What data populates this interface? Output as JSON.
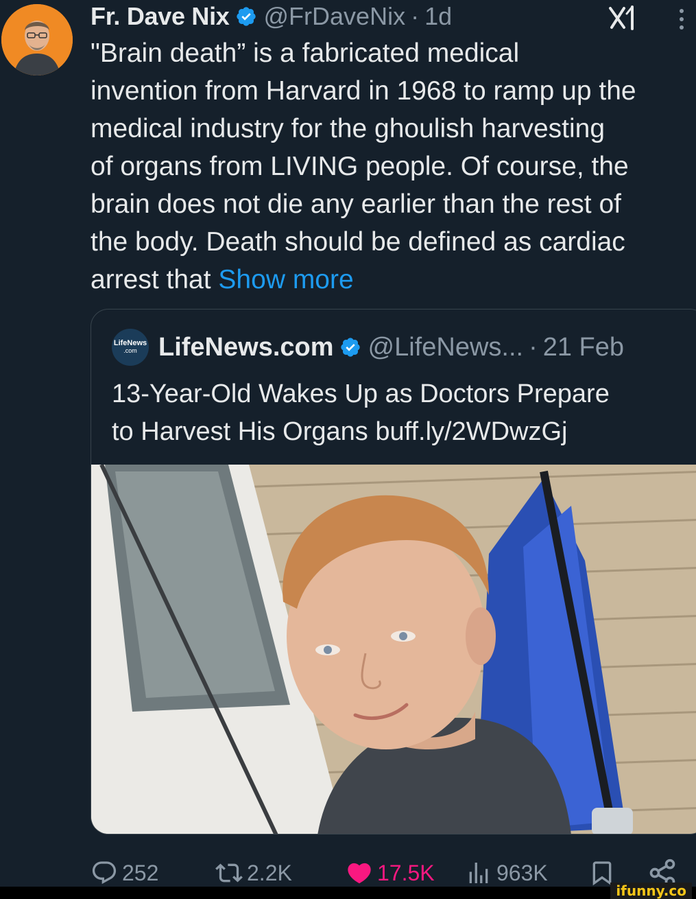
{
  "tweet": {
    "author_name": "Fr. Dave Nix",
    "handle": "@FrDaveNix",
    "separator": "·",
    "time": "1d",
    "text_lines": [
      "\"Brain death” is a fabricated medical",
      "invention from Harvard in 1968 to ramp up the",
      "medical industry for the ghoulish harvesting",
      "of organs from LIVING people.  Of course, the",
      "brain does not die any earlier than the rest of",
      "the body. Death should be defined as cardiac",
      "arrest that "
    ],
    "show_more": "Show more"
  },
  "quote": {
    "avatar_text": "LifeNews",
    "avatar_subtext": ".com",
    "author_name": "LifeNews.com",
    "handle": "@LifeNews...",
    "separator": "·",
    "date": "21 Feb",
    "text_lines": [
      "13-Year-Old Wakes Up as Doctors Prepare",
      "to Harvest His Organs buff.ly/2WDwzGj"
    ]
  },
  "actions": {
    "replies": "252",
    "reposts": "2.2K",
    "likes": "17.5K",
    "views": "963K"
  },
  "icons": {
    "verified": "verified-badge-icon",
    "grok": "grok-icon",
    "more": "more-vertical-icon",
    "reply": "reply-icon",
    "repost": "repost-icon",
    "like": "heart-icon",
    "views": "views-icon",
    "bookmark": "bookmark-icon",
    "share": "share-icon"
  },
  "colors": {
    "background": "#15202b",
    "text": "#e7e9ea",
    "muted": "#8b98a5",
    "link": "#1d9bf0",
    "like": "#f91880",
    "verified": "#1d9bf0"
  },
  "watermark": "ifunny.co"
}
